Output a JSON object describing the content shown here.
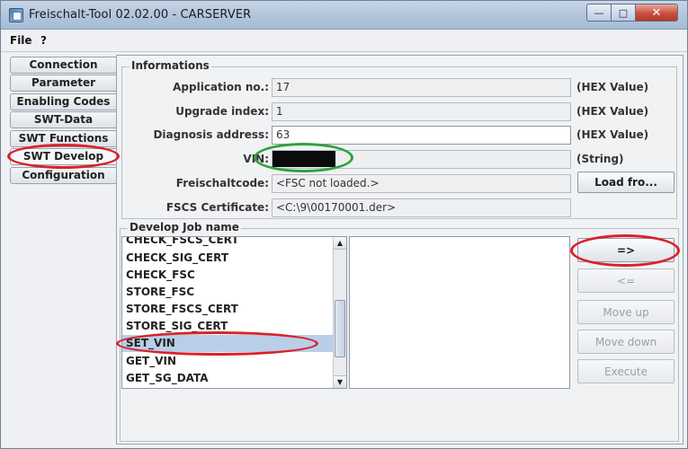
{
  "window": {
    "title": "Freischalt-Tool 02.02.00 - CARSERVER",
    "controls": {
      "minimize": "—",
      "maximize": "□",
      "close": "✕"
    }
  },
  "menu": [
    "File",
    "?"
  ],
  "tabs": [
    {
      "label": "Connection"
    },
    {
      "label": "Parameter"
    },
    {
      "label": "Enabling Codes"
    },
    {
      "label": "SWT-Data"
    },
    {
      "label": "SWT Functions"
    },
    {
      "label": "SWT Develop",
      "selected": true
    },
    {
      "label": "Configuration"
    }
  ],
  "informations": {
    "title": "Informations",
    "fields": [
      {
        "label": "Application no.:",
        "value": "17",
        "unit": "(HEX Value)"
      },
      {
        "label": "Upgrade index:",
        "value": "1",
        "unit": "(HEX Value)"
      },
      {
        "label": "Diagnosis address:",
        "value": "63",
        "unit": "(HEX Value)"
      },
      {
        "label": "VIN:",
        "value": "",
        "unit": "(String)"
      },
      {
        "label": "Freischaltcode:",
        "value": "<FSC not loaded.>",
        "button": "Load fro..."
      },
      {
        "label": "FSCS Certificate:",
        "value": "<C:\\9\\00170001.der>"
      }
    ]
  },
  "develop": {
    "title": "Develop Job name",
    "jobs": [
      "CHECK_FSCS_CERT",
      "CHECK_SIG_CERT",
      "CHECK_FSC",
      "STORE_FSC",
      "STORE_FSCS_CERT",
      "STORE_SIG_CERT",
      "SET_VIN",
      "GET_VIN",
      "GET_SG_DATA"
    ],
    "selected_job": "SET_VIN",
    "buttons": {
      "add": "=>",
      "remove": "<=",
      "move_up": "Move up",
      "move_down": "Move down",
      "execute": "Execute"
    }
  },
  "colors": {
    "annotation_red": "#d8232a",
    "annotation_green": "#2ea23a",
    "selection": "#b9cfe8"
  }
}
